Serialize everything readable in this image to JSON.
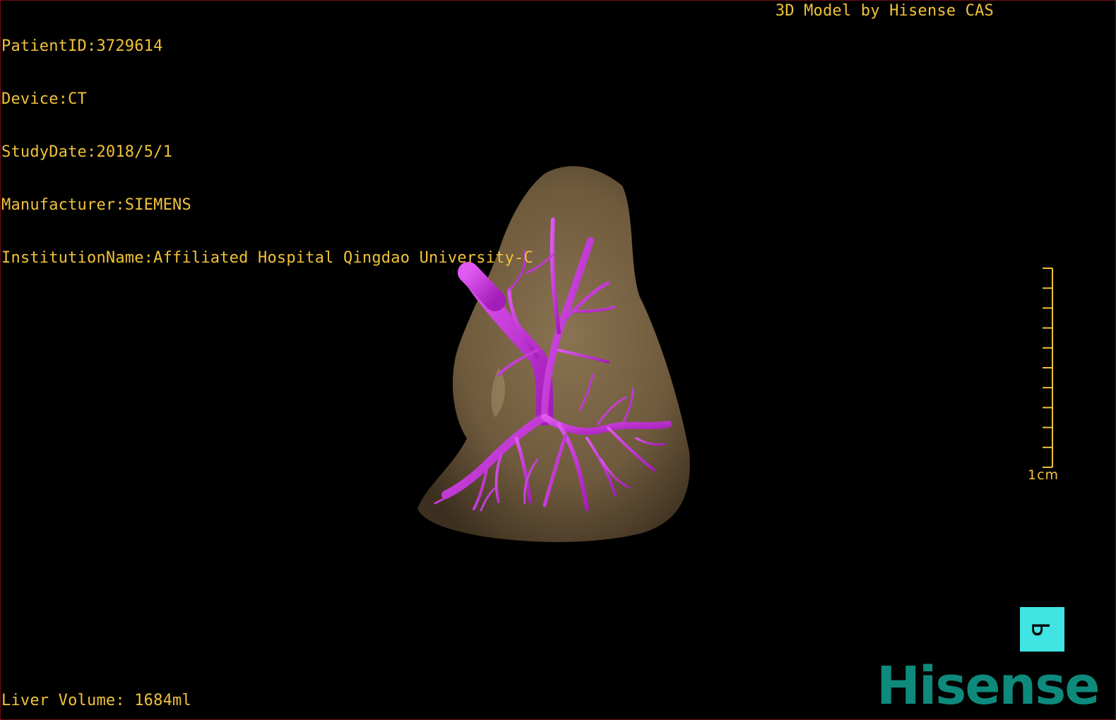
{
  "patient_info": {
    "patient_id": "PatientID:3729614",
    "device": "Device:CT",
    "study_date": "StudyDate:2018/5/1",
    "manufacturer": "Manufacturer:SIEMENS",
    "institution": "InstitutionName:Affiliated Hospital Qingdao University-C"
  },
  "model_credit": "3D Model by Hisense CAS",
  "liver_volume": "Liver Volume: 1684ml",
  "scale_bar": {
    "label": "1cm",
    "ticks": 10
  },
  "orientation_marker": {
    "letter": "P",
    "color": "#3fe4e3"
  },
  "brand_logo": "Hisense",
  "colors": {
    "overlay_text": "#f0c23a",
    "liver_surface": "#7a6344",
    "vessels": "#c42bd8",
    "brand": "#0e8a7c"
  }
}
